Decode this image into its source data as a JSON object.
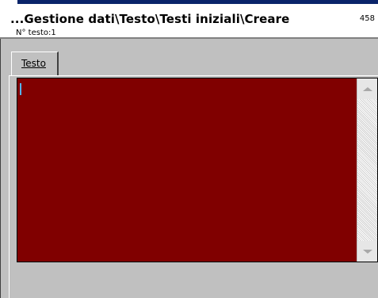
{
  "header": {
    "title": "...Gestione dati\\Testo\\Testi iniziali\\Creare",
    "code": "458",
    "subtitle": "N° testo:1"
  },
  "tabs": [
    {
      "label": "Testo",
      "selected": true
    }
  ],
  "editor": {
    "background": "#800000",
    "text": "",
    "scroll_up_icon": "scroll-up-arrow",
    "scroll_down_icon": "scroll-down-arrow"
  }
}
